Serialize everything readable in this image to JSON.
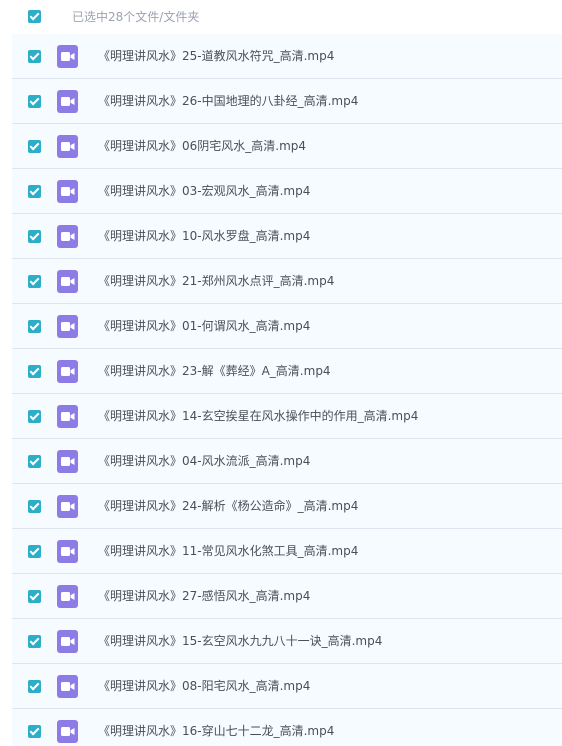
{
  "header": {
    "selection_label": "已选中28个文件/文件夹"
  },
  "files": [
    {
      "name": "《明理讲风水》25-道教风水符咒_高清.mp4"
    },
    {
      "name": "《明理讲风水》26-中国地理的八卦经_高清.mp4"
    },
    {
      "name": "《明理讲风水》06阴宅风水_高清.mp4"
    },
    {
      "name": "《明理讲风水》03-宏观风水_高清.mp4"
    },
    {
      "name": "《明理讲风水》10-风水罗盘_高清.mp4"
    },
    {
      "name": "《明理讲风水》21-郑州风水点评_高清.mp4"
    },
    {
      "name": "《明理讲风水》01-何谓风水_高清.mp4"
    },
    {
      "name": "《明理讲风水》23-解《葬经》A_高清.mp4"
    },
    {
      "name": "《明理讲风水》14-玄空挨星在风水操作中的作用_高清.mp4"
    },
    {
      "name": "《明理讲风水》04-风水流派_高清.mp4"
    },
    {
      "name": "《明理讲风水》24-解析《杨公造命》_高清.mp4"
    },
    {
      "name": "《明理讲风水》11-常见风水化煞工具_高清.mp4"
    },
    {
      "name": "《明理讲风水》27-感悟风水_高清.mp4"
    },
    {
      "name": "《明理讲风水》15-玄空风水九九八十一诀_高清.mp4"
    },
    {
      "name": "《明理讲风水》08-阳宅风水_高清.mp4"
    },
    {
      "name": "《明理讲风水》16-穿山七十二龙_高清.mp4"
    }
  ],
  "icons": {
    "checkbox": "checkbox-checked-icon",
    "file_type": "video-file-icon"
  },
  "colors": {
    "checkbox": "#2daec8",
    "video_icon": "#8e7ce6",
    "list_background": "#f6fbff",
    "row_divider": "#dde6ee",
    "file_text": "#4a4f57",
    "header_text": "#9aa3b0"
  }
}
